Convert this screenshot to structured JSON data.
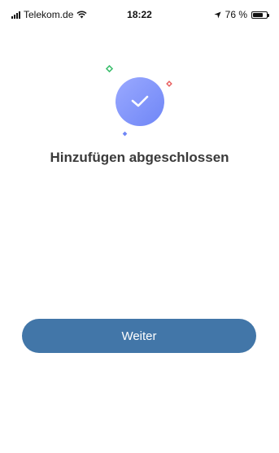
{
  "status_bar": {
    "carrier": "Telekom.de",
    "time": "18:22",
    "battery_text": "76 %",
    "battery_level": 0.76,
    "icons": [
      "signal-icon",
      "wifi-icon",
      "location-arrow-icon",
      "battery-icon"
    ]
  },
  "success": {
    "title": "Hinzufügen abgeschlossen",
    "icon": "checkmark-icon",
    "colors": {
      "badge_start": "#9aa9ff",
      "badge_end": "#6f86f6",
      "spark_green": "#3fbf6f",
      "spark_red": "#e85b5b",
      "spark_blue": "#6f86f6"
    }
  },
  "actions": {
    "continue_label": "Weiter",
    "button_color": "#4276a8"
  }
}
